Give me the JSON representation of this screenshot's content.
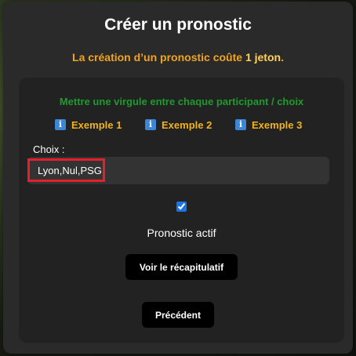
{
  "modal": {
    "title": "Créer un pronostic",
    "close_label": "×",
    "cost_prefix": "La création d’un pronostic coûte ",
    "cost_tokens": "1 jeton",
    "cost_suffix": "."
  },
  "form": {
    "hint": "Mettre une virgule entre chaque participant / choix",
    "examples": [
      {
        "icon": "info-icon",
        "label": "Exemple 1"
      },
      {
        "icon": "info-icon",
        "label": "Exemple 2"
      },
      {
        "icon": "info-icon",
        "label": "Exemple 3"
      }
    ],
    "choice_label": "Choix :",
    "choice_value": "Lyon,Nul,PSG",
    "active_checked": true,
    "active_label": "Pronostic actif",
    "summary_button": "Voir le récapitulatif",
    "previous_button": "Précédent"
  },
  "colors": {
    "cost_text": "#f2a41d",
    "hint_text": "#1f9a2e",
    "example_text": "#f2b21b",
    "highlight_border": "#e5202c",
    "checkbox": "#1a73e8"
  }
}
